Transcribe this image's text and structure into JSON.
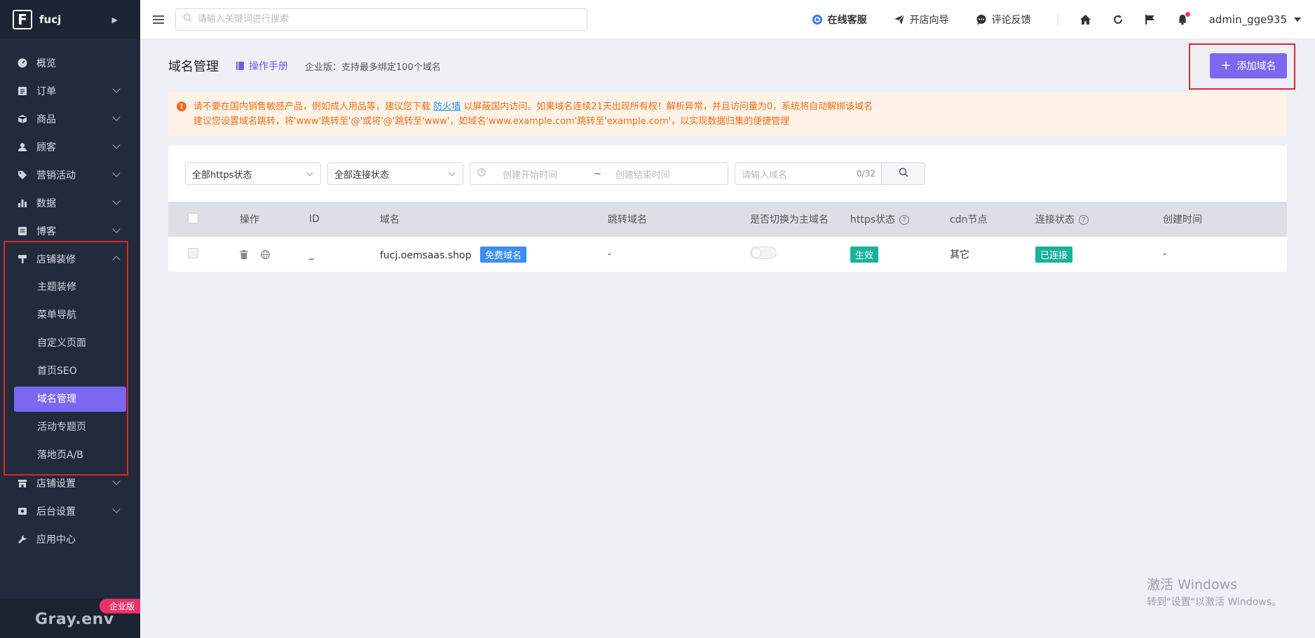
{
  "brand": {
    "logo_letter": "F",
    "name": "fucj"
  },
  "sidebar": {
    "items": [
      {
        "label": "概览",
        "icon": "dashboard-icon"
      },
      {
        "label": "订单",
        "icon": "order-icon"
      },
      {
        "label": "商品",
        "icon": "box-icon"
      },
      {
        "label": "顾客",
        "icon": "user-icon"
      },
      {
        "label": "营销活动",
        "icon": "tag-icon"
      },
      {
        "label": "数据",
        "icon": "bar-chart-icon"
      },
      {
        "label": "博客",
        "icon": "blog-icon"
      },
      {
        "label": "店铺装修",
        "icon": "brush-icon"
      }
    ],
    "submenu": [
      "主题装修",
      "菜单导航",
      "自定义页面",
      "首页SEO",
      "域名管理",
      "活动专题页",
      "落地页A/B"
    ],
    "active_sub": "域名管理",
    "items_after": [
      {
        "label": "店铺设置",
        "icon": "store-icon"
      },
      {
        "label": "后台设置",
        "icon": "settings-icon"
      },
      {
        "label": "应用中心",
        "icon": "wrench-icon"
      }
    ],
    "footer_env": "Gray.env",
    "footer_badge": "企业版"
  },
  "header": {
    "search_placeholder": "请输入关键词进行搜索",
    "online_service": "在线客服",
    "store_guide": "开店向导",
    "feedback": "评论反馈",
    "username": "admin_gge935"
  },
  "page": {
    "title": "域名管理",
    "manual": "操作手册",
    "plan_note": "企业版：支持最多绑定100个域名",
    "add_button": "添加域名",
    "alert_line1_a": "请不要在国内销售敏感产品，例如成人用品等，建议您下载",
    "alert_link": "防火墙",
    "alert_line1_b": "以屏蔽国内访问。如果域名连续21天出现所有权！解析异常，并且访问量为0，系统将自动解绑该域名",
    "alert_line2": "建议您设置域名跳转，将'www'跳转至'@'或将'@'跳转至'www'，如域名'www.example.com'跳转至'example.com'，以实现数据归集的便捷管理"
  },
  "filters": {
    "https_status": "全部https状态",
    "conn_status": "全部连接状态",
    "start_placeholder": "创建开始时间",
    "tilde": "~",
    "end_placeholder": "创建结束时间",
    "domain_placeholder": "请输入域名",
    "counter": "0/32"
  },
  "table": {
    "headers": [
      "操作",
      "ID",
      "域名",
      "跳转域名",
      "是否切换为主域名",
      "https状态",
      "cdn节点",
      "连接状态",
      "创建时间"
    ],
    "rows": [
      {
        "id": "_",
        "domain": "fucj.oemsaas.shop",
        "domain_tag": "免费域名",
        "redirect": "-",
        "https": "生效",
        "cdn": "其它",
        "conn": "已连接",
        "created": "-"
      }
    ]
  },
  "windows_watermark": {
    "line1": "激活 Windows",
    "line2": "转到\"设置\"以激活 Windows。"
  },
  "colors": {
    "accent": "#7a68f0",
    "sidebar_bg": "#222b3c",
    "alert_text": "#ef6d1a",
    "tag_blue": "#3b8ff0",
    "tag_teal": "#19b29c"
  }
}
